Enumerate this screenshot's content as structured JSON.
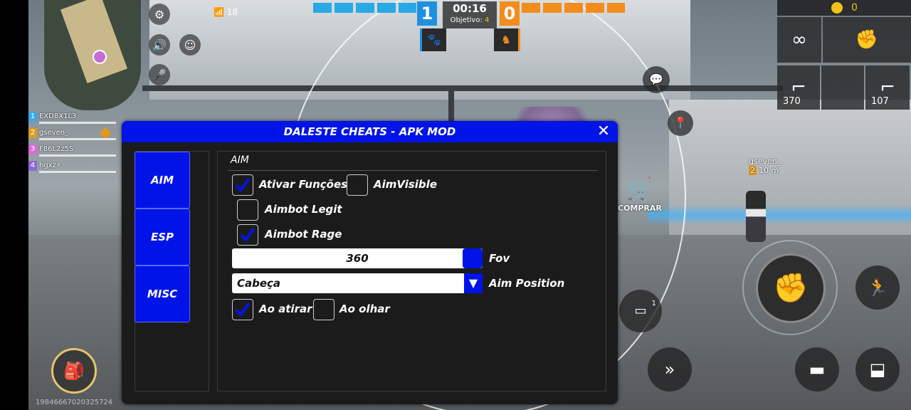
{
  "hud": {
    "wifi": "18",
    "score_blue": "1",
    "score_orange": "0",
    "timer": "00:16",
    "objective_label": "Objetivo:",
    "objective_value": "4",
    "coins": "0",
    "ammo_primary": "370",
    "ammo_secondary": "107",
    "buy_label": "COMPRAR",
    "enemy_name": "gseven_.",
    "enemy_level": "2",
    "enemy_distance": "10 m",
    "grenade_count": "1",
    "uid": "19846667020325724"
  },
  "team": [
    {
      "num": "1",
      "name": "EXD8X1L3",
      "color": "#3aa8e6"
    },
    {
      "num": "2",
      "name": "gseven_.",
      "color": "#e09a1e"
    },
    {
      "num": "3",
      "name": "F86L2z5S",
      "color": "#d86ad8"
    },
    {
      "num": "4",
      "name": "hgxz⚡",
      "color": "#8a6ad8"
    }
  ],
  "panel": {
    "title": "DALESTE CHEATS - APK MOD",
    "tabs": [
      "AIM",
      "ESP",
      "MISC"
    ],
    "section": "AIM",
    "opt_ativar": "Ativar Funções",
    "opt_aimvisible": "AimVisible",
    "opt_legit": "Aimbot Legit",
    "opt_rage": "Aimbot Rage",
    "fov_value": "360",
    "fov_label": "Fov",
    "aimpos_value": "Cabeça",
    "aimpos_label": "Aim Position",
    "opt_atirar": "Ao atirar",
    "opt_olhar": "Ao olhar",
    "checked": {
      "ativar": true,
      "aimvisible": false,
      "legit": false,
      "rage": true,
      "atirar": true,
      "olhar": false
    }
  },
  "colors": {
    "accent": "#0014e8",
    "blue_team": "#1e90e0",
    "orange_team": "#f28c1c"
  }
}
